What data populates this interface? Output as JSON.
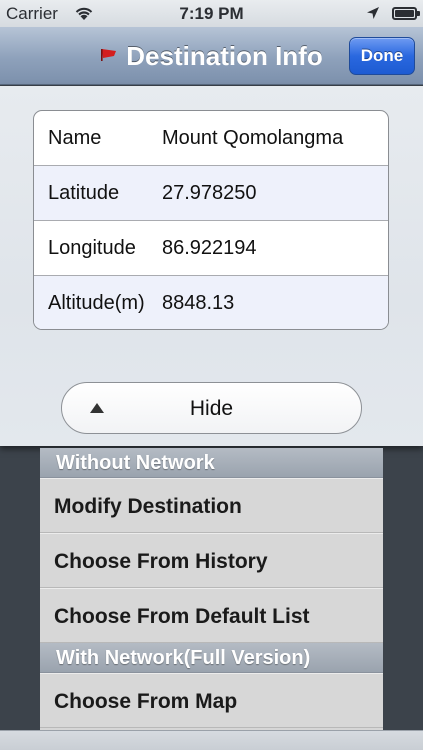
{
  "status_bar": {
    "carrier": "Carrier",
    "time": "7:19 PM"
  },
  "nav": {
    "title": "Destination Info",
    "done_label": "Done",
    "flag_color": "#d41e1e"
  },
  "destination": {
    "rows": [
      {
        "label": "Name",
        "value": "Mount Qomolangma"
      },
      {
        "label": "Latitude",
        "value": "27.978250"
      },
      {
        "label": "Longitude",
        "value": "86.922194"
      },
      {
        "label": "Altitude(m)",
        "value": "8848.13"
      }
    ]
  },
  "hide_button": {
    "label": "Hide",
    "icon": "triangle-up-icon"
  },
  "options": {
    "without_network": {
      "header": "Without Network",
      "items": [
        "Modify Destination",
        "Choose From History",
        "Choose From Default List"
      ]
    },
    "with_network": {
      "header": "With Network(Full Version)",
      "items": [
        "Choose From Map"
      ]
    }
  }
}
